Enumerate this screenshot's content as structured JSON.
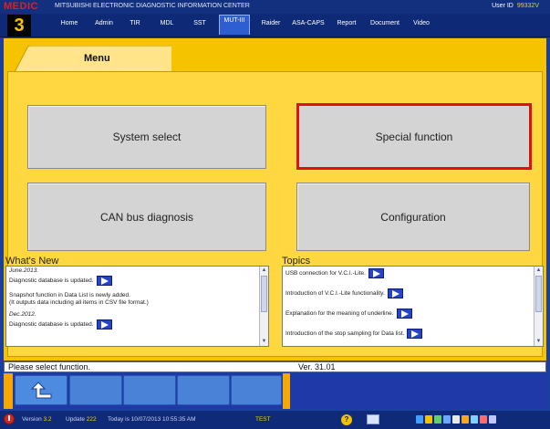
{
  "header": {
    "logo_text": "MEDIC",
    "logo_number": "3",
    "app_title": "MITSUBISHI ELECTRONIC DIAGNOSTIC INFORMATION CENTER",
    "user_label": "User ID",
    "user_id": "99332V"
  },
  "nav": {
    "items": [
      "Home",
      "Admin",
      "TIR",
      "MDL",
      "SST",
      "MUT-III",
      "Raider",
      "ASA-CAPS",
      "Report",
      "Document",
      "Video"
    ],
    "active": "MUT-III"
  },
  "menu": {
    "tab_label": "Menu",
    "buttons": {
      "system_select": "System select",
      "special_function": "Special function",
      "can_bus_diagnosis": "CAN bus diagnosis",
      "configuration": "Configuration"
    },
    "selected": "special_function"
  },
  "whats_new": {
    "title": "What's New",
    "lines": [
      "June.2013.",
      "Diagnostic database is updated.",
      "Snapshot function in Data List is newly added.",
      "(It outputs data including all items in CSV file format.)",
      "Dec.2012.",
      "Diagnostic database is updated."
    ]
  },
  "topics": {
    "title": "Topics",
    "items": [
      "USB connection for V.C.I.-Lite.",
      "Introduction of V.C.I.-Lite functionality.",
      "Explanation for the meaning of underline.",
      "Introduction of the stop sampling for Data list."
    ]
  },
  "status": {
    "message": "Please select function.",
    "version": "Ver. 31.01"
  },
  "footer": {
    "version_label": "Version",
    "version_value": "3.2",
    "update_label": "Update",
    "update_value": "222",
    "today_label": "Today is",
    "today_value": "10/07/2013 10:55:35 AM",
    "mode": "TEST"
  },
  "colors": {
    "panel": "#f6c300",
    "chrome": "#1a3f9c",
    "selected_border": "#e01010",
    "button_gray": "#d4d4d4"
  },
  "icons": {
    "back": "back-arrow-icon",
    "power": "power-icon",
    "help": "help-icon",
    "screen": "screen-icon",
    "list_link": "right-arrow-icon"
  }
}
